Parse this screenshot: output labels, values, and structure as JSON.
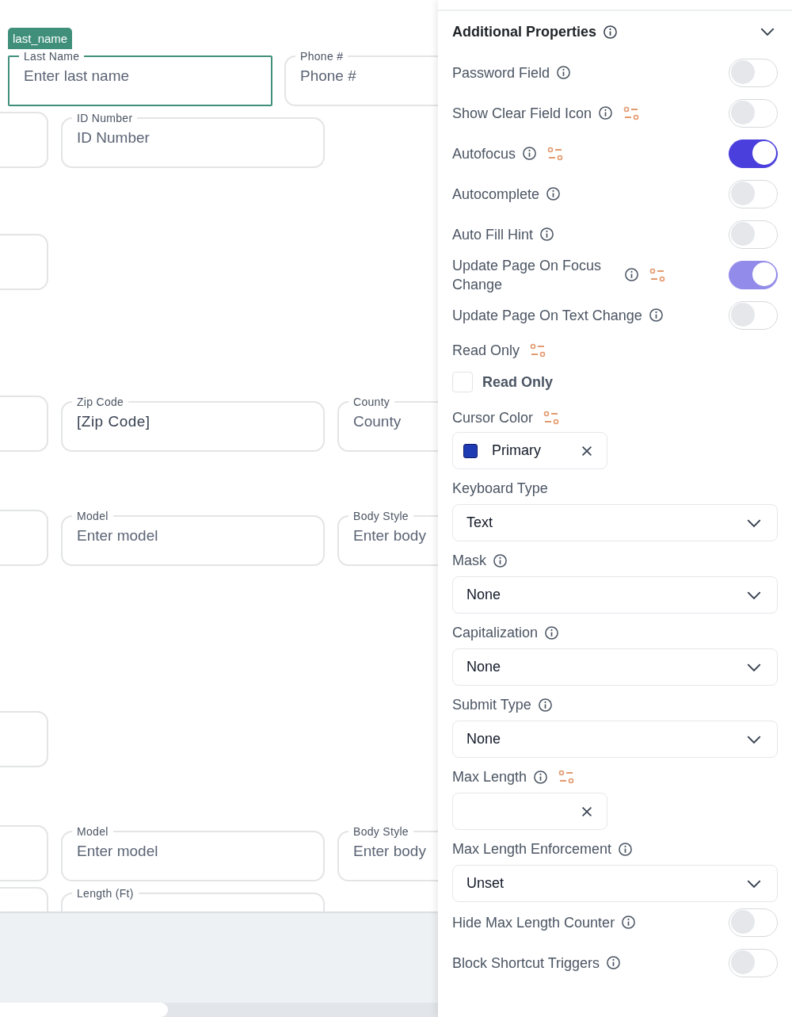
{
  "canvas": {
    "fields": [
      {
        "label": "Last Name",
        "placeholder": "Enter last name",
        "selected": true,
        "tag": "last_name"
      },
      {
        "label": "Phone #",
        "placeholder": "Phone #",
        "selected": false
      },
      {
        "selected": false
      },
      {
        "label": "ID Number",
        "placeholder": "ID Number",
        "selected": false
      },
      {
        "selected": false
      },
      {
        "selected": false
      },
      {
        "label": "Zip Code",
        "value": "[Zip Code]",
        "selected": false
      },
      {
        "label": "County",
        "placeholder": "County",
        "selected": false
      },
      {
        "selected": false
      },
      {
        "label": "Model",
        "placeholder": "Enter model",
        "selected": false
      },
      {
        "label": "Body Style",
        "placeholder": "Enter body",
        "selected": false
      },
      {
        "selected": false
      },
      {
        "selected": false
      },
      {
        "label": "Model",
        "placeholder": "Enter model",
        "selected": false
      },
      {
        "label": "Body Style",
        "placeholder": "Enter body",
        "selected": false
      },
      {
        "selected": false
      },
      {
        "label": "Length (Ft)",
        "selected": false
      }
    ]
  },
  "panel": {
    "title": "Additional Properties",
    "title_info": true,
    "expanded": true,
    "properties": [
      {
        "kind": "toggle",
        "label": "Password Field",
        "info": true,
        "binding": false,
        "on": false,
        "disabled": false
      },
      {
        "kind": "toggle",
        "label": "Show Clear Field Icon",
        "info": true,
        "binding": true,
        "on": false,
        "disabled": false
      },
      {
        "kind": "toggle",
        "label": "Autofocus",
        "info": true,
        "binding": true,
        "on": true,
        "disabled": false
      },
      {
        "kind": "toggle",
        "label": "Autocomplete",
        "info": true,
        "binding": false,
        "on": false,
        "disabled": false
      },
      {
        "kind": "toggle",
        "label": "Auto Fill Hint",
        "info": true,
        "binding": false,
        "on": false,
        "disabled": false
      },
      {
        "kind": "toggle",
        "label": "Update Page On Focus Change",
        "info": true,
        "binding": true,
        "on": true,
        "disabled": true
      },
      {
        "kind": "toggle",
        "label": "Update Page On Text Change",
        "info": true,
        "binding": false,
        "on": false,
        "disabled": false
      },
      {
        "kind": "checkbox",
        "label": "Read Only",
        "info": false,
        "binding": true,
        "checkbox_label": "Read Only",
        "checked": false
      },
      {
        "kind": "color",
        "label": "Cursor Color",
        "info": false,
        "binding": true,
        "value": "Primary",
        "color": "#1f3bb3"
      },
      {
        "kind": "select",
        "label": "Keyboard Type",
        "info": false,
        "binding": false,
        "value": "Text"
      },
      {
        "kind": "select",
        "label": "Mask",
        "info": true,
        "binding": false,
        "value": "None"
      },
      {
        "kind": "select",
        "label": "Capitalization",
        "info": true,
        "binding": false,
        "value": "None"
      },
      {
        "kind": "select",
        "label": "Submit Type",
        "info": true,
        "binding": false,
        "value": "None"
      },
      {
        "kind": "text",
        "label": "Max Length",
        "info": true,
        "binding": true
      },
      {
        "kind": "select",
        "label": "Max Length Enforcement",
        "info": true,
        "binding": false,
        "value": "Unset"
      },
      {
        "kind": "toggle",
        "label": "Hide Max Length Counter",
        "info": true,
        "binding": false,
        "on": false,
        "disabled": false
      },
      {
        "kind": "toggle",
        "label": "Block Shortcut Triggers",
        "info": true,
        "binding": false,
        "on": false,
        "disabled": false
      }
    ]
  }
}
